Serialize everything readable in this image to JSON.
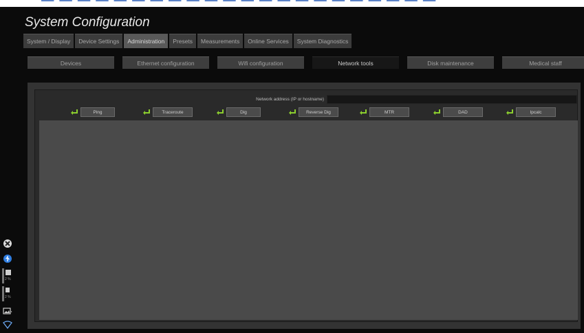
{
  "window": {
    "title": "System Configuration"
  },
  "tabs": [
    {
      "label": "System / Display",
      "active": false
    },
    {
      "label": "Device Settings",
      "active": false
    },
    {
      "label": "Administration",
      "active": true
    },
    {
      "label": "Presets",
      "active": false
    },
    {
      "label": "Measurements",
      "active": false
    },
    {
      "label": "Online Services",
      "active": false
    },
    {
      "label": "System Diagnostics",
      "active": false
    }
  ],
  "subtabs": [
    {
      "label": "Devices",
      "active": false
    },
    {
      "label": "Ethernet configuration",
      "active": false
    },
    {
      "label": "Wifi configuration",
      "active": false
    },
    {
      "label": "Network tools",
      "active": true
    },
    {
      "label": "Disk maintenance",
      "active": false
    },
    {
      "label": "Medical staff",
      "active": false
    }
  ],
  "network": {
    "address_label": "Network address (IP or hostname)",
    "address_value": "",
    "tools": [
      {
        "label": "Ping"
      },
      {
        "label": "Traceroute"
      },
      {
        "label": "Dig"
      },
      {
        "label": "Reverse Dig"
      },
      {
        "label": "MTR"
      },
      {
        "label": "DAD"
      },
      {
        "label": "Ipcalc"
      }
    ]
  },
  "side": {
    "icons": [
      "close-circle-icon",
      "usb-icon",
      "printer-meter",
      "volume-meter",
      "image-icon",
      "wifi-icon"
    ],
    "meter1_pct": "2 %",
    "meter2_pct": "2 %"
  },
  "colors": {
    "background": "#0b0b0b",
    "tab_active": "#595959",
    "subtab_active": "#171717",
    "enter_icon": "#8ccf2e",
    "usb_blue": "#2f7de0"
  }
}
